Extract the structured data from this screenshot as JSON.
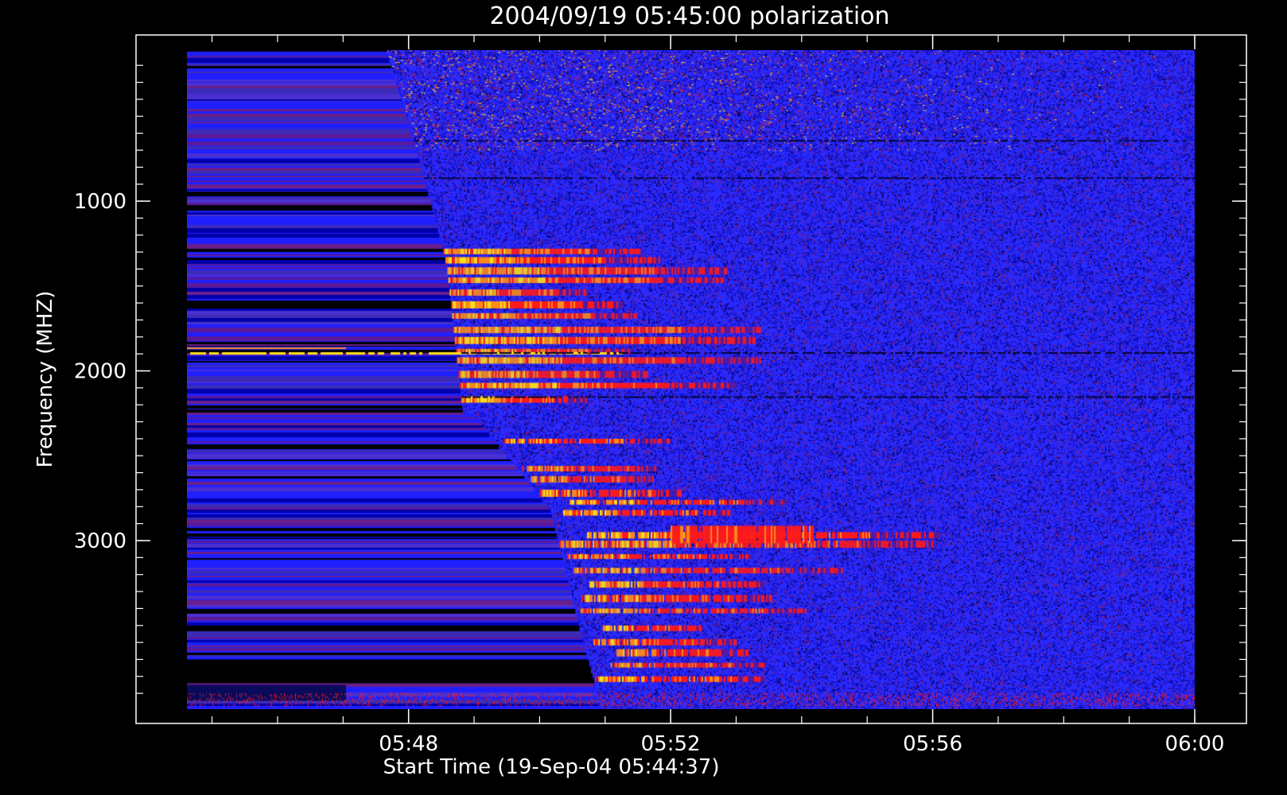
{
  "chart_data": {
    "type": "heatmap",
    "title": "2004/09/19 05:45:00 polarization",
    "xlabel": "Start Time (19-Sep-04 05:44:37)",
    "ylabel": "Frequency (MHZ)",
    "x_axis": {
      "range": [
        "05:44:37",
        "06:00:00"
      ],
      "ticks": [
        "05:48",
        "05:52",
        "05:56",
        "06:00"
      ],
      "minor_ticks_per_major": 4
    },
    "y_axis": {
      "range": [
        3980,
        120
      ],
      "inverted": true,
      "ticks": [
        1000,
        2000,
        3000
      ],
      "minor_tick_step": 100
    },
    "colormap": [
      "#000000",
      "#5a1a9a",
      "#1f1fff",
      "#ff1a1a",
      "#ff8c1a",
      "#ffe01a"
    ],
    "features": [
      {
        "kind": "burst-onset",
        "time_start": "05:47:40",
        "freq_start": 700,
        "time_end": "05:48:40",
        "freq_end": 1900
      },
      {
        "kind": "emission-lanes",
        "freq_range": [
          1200,
          2200
        ],
        "time_range": [
          "05:48:40",
          "05:51:00"
        ]
      },
      {
        "kind": "drifting-emission",
        "freq_range": [
          2300,
          3900
        ],
        "time_range": [
          "05:49:00",
          "05:54:00"
        ]
      },
      {
        "kind": "strong-band",
        "freq": 2950,
        "time_range": [
          "05:52:00",
          "05:54:00"
        ]
      }
    ]
  }
}
